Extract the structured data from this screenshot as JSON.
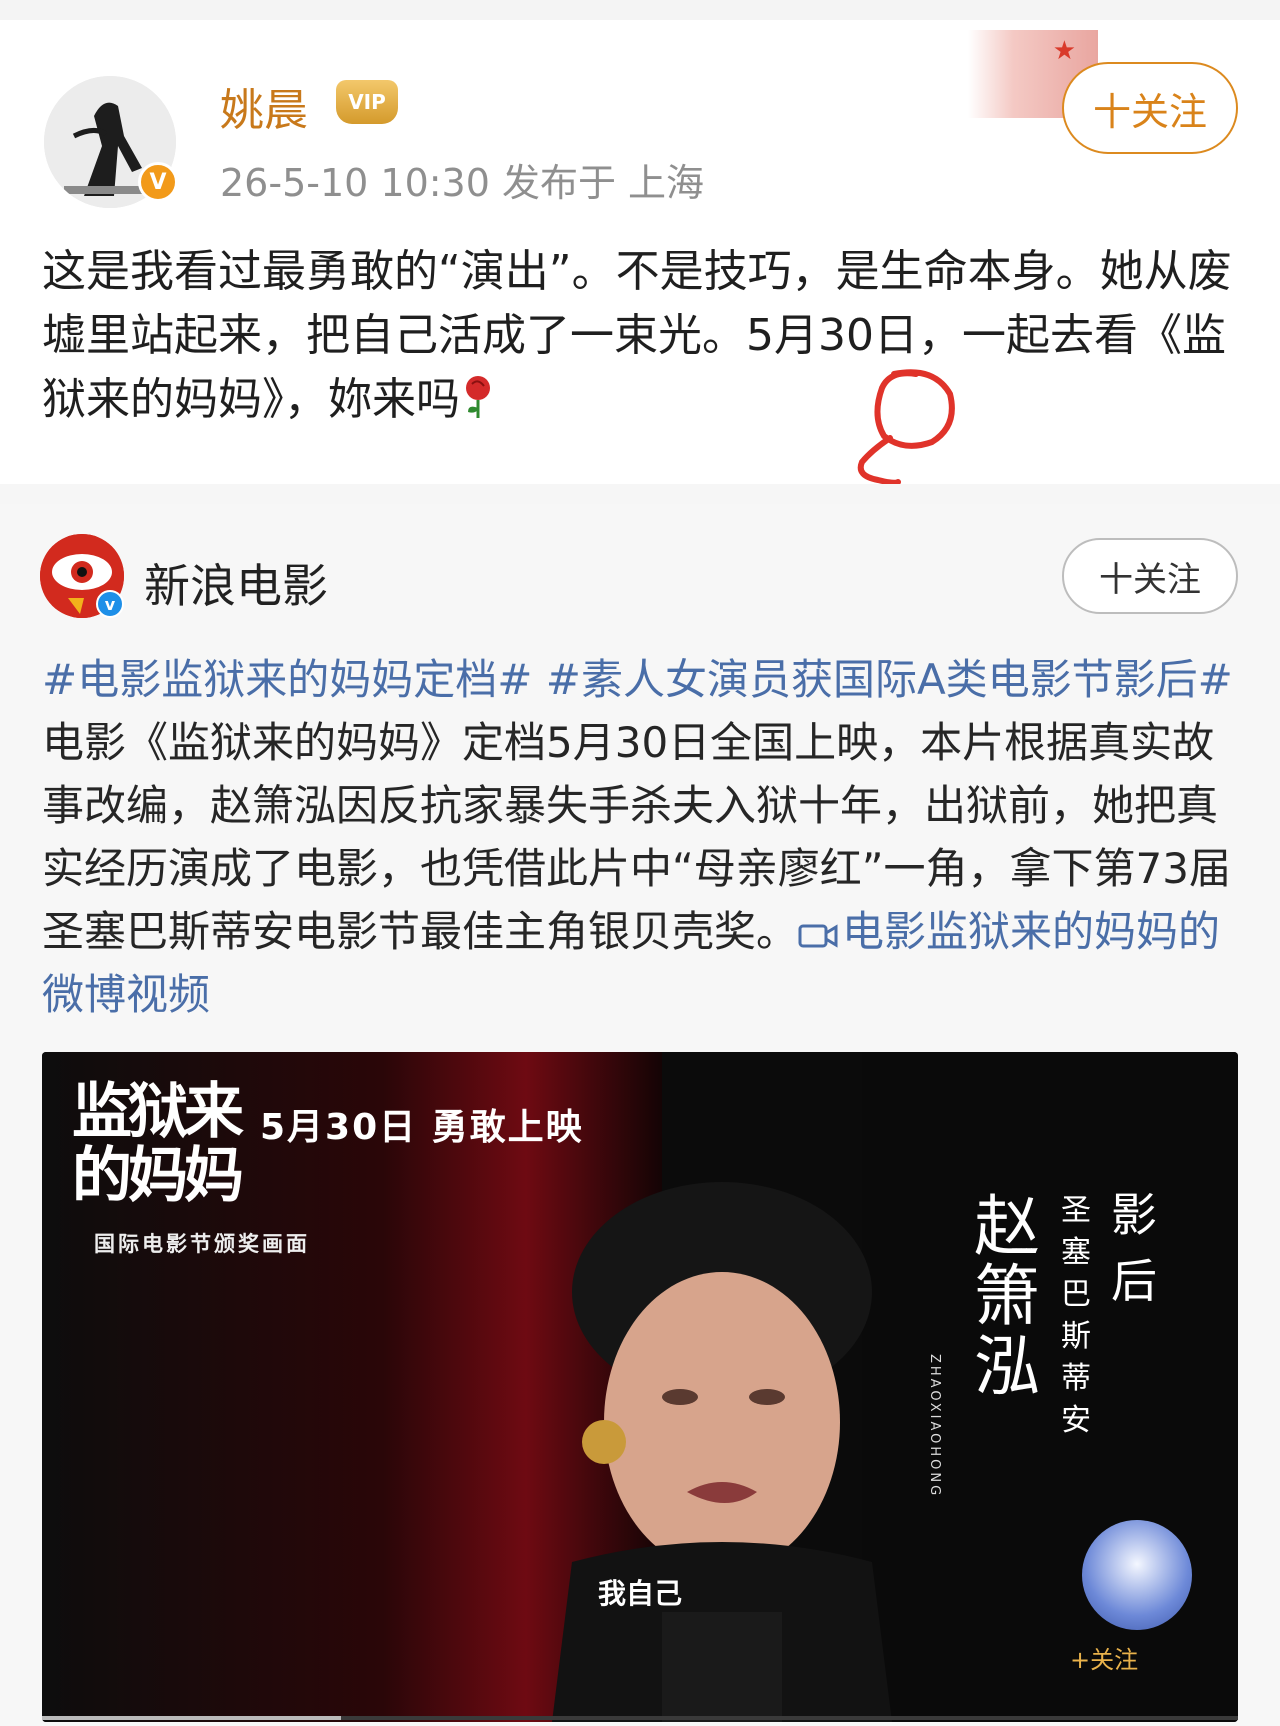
{
  "post": {
    "author": "姚晨",
    "vip_badge": "VIP",
    "verified_mark": "V",
    "meta": "26-5-10 10:30  发布于 上海",
    "follow_label": "十关注",
    "text_before_highlight": "这是我看过最勇敢的“演出”。不是技巧，是生命本身。她从废墟里站起来，把自己活成了一束光。5月30日，一起去看《监狱来的妈妈》，",
    "text_highlight": "妳来",
    "text_after_highlight": "吗",
    "emoji": "rose-emoji"
  },
  "repost": {
    "author": "新浪电影",
    "verified_mark": "v",
    "follow_label": "十关注",
    "tag1": "#电影监狱来的妈妈定档#",
    "tag2": "#素人女演员获国际A类电影节影后#",
    "body": " 电影《监狱来的妈妈》定档5月30日全国上映，本片根据真实故事改编，赵箫泓因反抗家暴失手杀夫入狱十年，出狱前，她把真实经历演成了电影，也凭借此片中“母亲廖红”一角，拿下第73届圣塞巴斯蒂安电影节最佳主角银贝壳奖。",
    "video_link": "电影监狱来的妈妈的微博视频"
  },
  "video": {
    "movie_logo": "监狱来的妈妈",
    "release": "5月30日  勇敢上映",
    "caption_left": "国际电影节颁奖画面",
    "actress_name": "赵箫泓",
    "actress_pinyin": "ZHAOXIAOHONG",
    "award_festival": "圣塞巴斯蒂安",
    "award_title": "影后",
    "subtitle": "我自己",
    "follow_overlay": "+关注",
    "progress": 0.25
  },
  "colors": {
    "author_orange": "#c8791b",
    "link_blue": "#4a6ea8",
    "annotation_red": "#e0332a"
  }
}
